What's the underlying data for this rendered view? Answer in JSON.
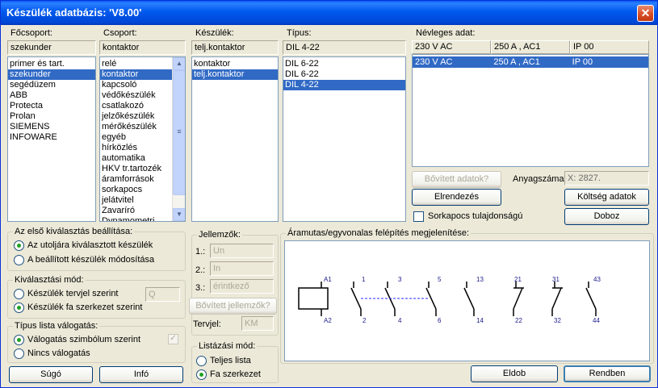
{
  "window": {
    "title": "Készülék adatbázis: 'V8.00'",
    "close_glyph": "✕"
  },
  "focsoport": {
    "label": "Főcsoport:",
    "value": "szekunder",
    "items": [
      "primer és tart.",
      "szekunder",
      "segédüzem",
      "ABB",
      "Protecta",
      "Prolan",
      "SIEMENS",
      "INFOWARE"
    ],
    "selected_index": 1
  },
  "csoport": {
    "label": "Csoport:",
    "value": "kontaktor",
    "items": [
      "relé",
      "kontaktor",
      "kapcsoló",
      "védőkészülék",
      "csatlakozó",
      "jelzőkészülék",
      "mérőkészülék",
      "egyéb",
      "hírközlés",
      "automatika",
      "HKV tr.tartozék",
      "áramforrások",
      "sorkapocs",
      "jelátvitel",
      "Zavaríró",
      "Dynamometri"
    ],
    "selected_index": 1
  },
  "keszulek": {
    "label": "Készülék:",
    "value": "telj.kontaktor",
    "items": [
      "kontaktor",
      "telj.kontaktor"
    ],
    "selected_index": 1
  },
  "tipus": {
    "label": "Típus:",
    "value": "DIL 4-22",
    "items": [
      "DIL 6-22",
      "DIL 6-22",
      "DIL 4-22"
    ],
    "selected_index": 2
  },
  "nevleges": {
    "label": "Névleges adat:",
    "header": [
      "230 V AC",
      "250 A , AC1",
      "IP 00"
    ],
    "row": [
      "230 V AC",
      "250 A , AC1",
      "IP 00"
    ]
  },
  "actions": {
    "bovitett_adatok": "Bővített adatok?",
    "anyagszama_label": "Anyagszáma:",
    "anyagszama_value": "X: 2827.",
    "elrendezes": "Elrendezés",
    "koltseg": "Költség adatok",
    "sorkapocs_label": "Sorkapocs tulajdonságú",
    "doboz": "Doboz"
  },
  "first_selection": {
    "title": "Az első kiválasztás beállítása:",
    "options": [
      "Az utoljára kiválasztott készülék",
      "A beállított készülék módosítása"
    ],
    "selected": 0
  },
  "kivalasztasi": {
    "title": "Kiválasztási mód:",
    "options": [
      "Készülék tervjel szerint",
      "Készülék fa szerkezet szerint"
    ],
    "selected": 1,
    "input_value": "Q"
  },
  "tipus_lista": {
    "title": "Típus lista válogatás:",
    "options": [
      "Válogatás szimbólum szerint",
      "Nincs válogatás"
    ],
    "selected": 0,
    "check_glyph": "✓"
  },
  "jellemzok": {
    "title": "Jellemzők:",
    "rows": [
      {
        "label": "1.:",
        "value": "Un"
      },
      {
        "label": "2.:",
        "value": "In"
      },
      {
        "label": "3.:",
        "value": "érintkező"
      }
    ],
    "bovitett": "Bővített jellemzők?",
    "tervjel_label": "Tervjel:",
    "tervjel_value": "KM"
  },
  "listazasi": {
    "title": "Listázási mód:",
    "options": [
      "Teljes lista",
      "Fa szerkezet"
    ],
    "selected": 1
  },
  "diagram": {
    "title": "Áramutas/egyvonalas felépítés megjelenítése:",
    "coil_top": "A1",
    "coil_bottom": "A2",
    "contacts": [
      {
        "top": "1",
        "bottom": "2"
      },
      {
        "top": "3",
        "bottom": "4"
      },
      {
        "top": "5",
        "bottom": "6"
      },
      {
        "top": "13",
        "bottom": "14"
      },
      {
        "top": "21",
        "bottom": "22"
      },
      {
        "top": "31",
        "bottom": "32"
      },
      {
        "top": "43",
        "bottom": "44"
      }
    ]
  },
  "footer": {
    "help": "Súgó",
    "info": "Infó",
    "back": "Eldob",
    "ok": "Rendben"
  },
  "scroll": {
    "up": "▲",
    "down": "▼",
    "grip": "≡"
  }
}
